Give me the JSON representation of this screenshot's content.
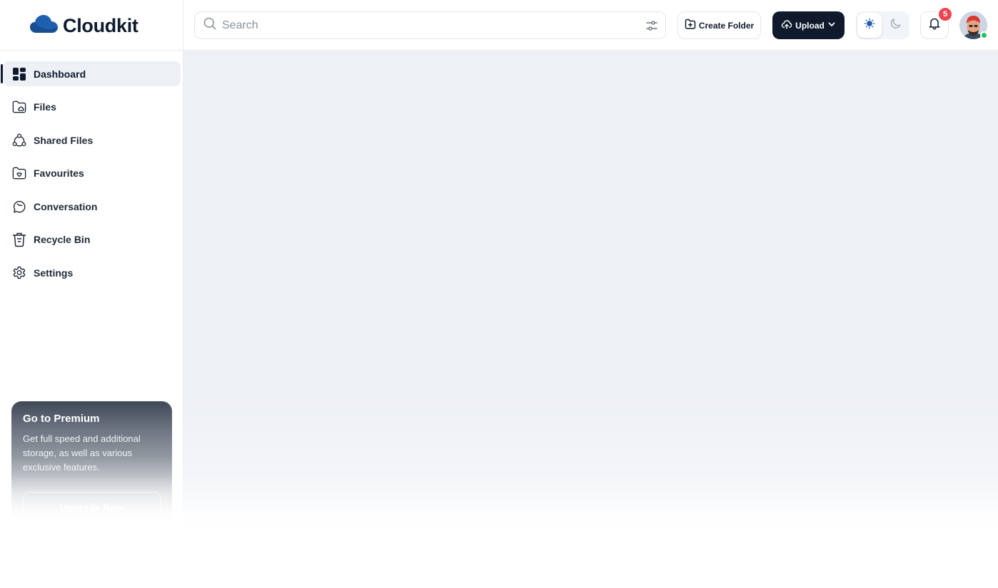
{
  "app": {
    "name": "Cloudkit"
  },
  "sidebar": {
    "items": [
      {
        "label": "Dashboard",
        "icon": "dashboard-icon",
        "active": true
      },
      {
        "label": "Files",
        "icon": "files-icon",
        "active": false
      },
      {
        "label": "Shared Files",
        "icon": "shared-files-icon",
        "active": false
      },
      {
        "label": "Favourites",
        "icon": "favourites-icon",
        "active": false
      },
      {
        "label": "Conversation",
        "icon": "conversation-icon",
        "active": false
      },
      {
        "label": "Recycle Bin",
        "icon": "recycle-bin-icon",
        "active": false
      },
      {
        "label": "Settings",
        "icon": "settings-icon",
        "active": false
      }
    ],
    "premium": {
      "title": "Go to Premium",
      "description": "Get full speed and additional storage, as well as various exclusive features.",
      "button_label": "Upgrade Now"
    }
  },
  "header": {
    "search": {
      "placeholder": "Search",
      "value": ""
    },
    "create_folder_label": "Create Folder",
    "upload_label": "Upload",
    "theme": {
      "selected": "light"
    },
    "notifications": {
      "count": "5"
    }
  },
  "colors": {
    "brand_dark": "#0f1b2d",
    "logo_blue": "#1e5fae",
    "badge_red": "#ef4452",
    "online_green": "#22c55e",
    "main_bg": "#edf0f5"
  }
}
